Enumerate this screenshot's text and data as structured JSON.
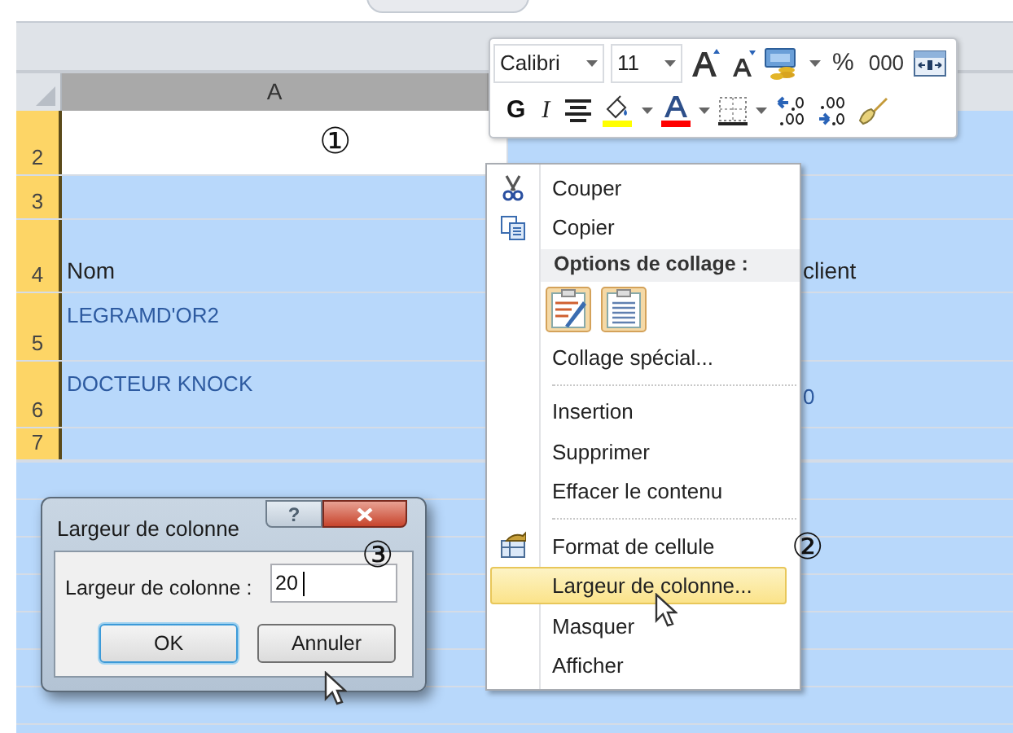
{
  "sheet": {
    "columns": [
      {
        "label": "A",
        "selected": true
      }
    ],
    "rows": [
      {
        "number": "2",
        "selected": true,
        "active": true
      },
      {
        "number": "3",
        "selected": true,
        "active": false
      },
      {
        "number": "4",
        "selected": true,
        "active": false,
        "kind": "heading",
        "a": "Nom",
        "b": "client"
      },
      {
        "number": "5",
        "selected": true,
        "active": false,
        "kind": "data",
        "a": "LEGRAMD'OR2"
      },
      {
        "number": "6",
        "selected": true,
        "active": false,
        "kind": "data",
        "a": "DOCTEUR KNOCK",
        "b": "0"
      },
      {
        "number": "7",
        "selected": true,
        "active": false
      }
    ]
  },
  "mini_toolbar": {
    "font": "Calibri",
    "size": "11",
    "percent": "%",
    "thousands": "000",
    "bold": "G",
    "italic": "I"
  },
  "context_menu": {
    "items": [
      {
        "kind": "item",
        "label": "Couper",
        "selected": false
      },
      {
        "kind": "item",
        "label": "Copier",
        "selected": false
      },
      {
        "kind": "header",
        "label": "Options de collage :"
      },
      {
        "kind": "paste_options"
      },
      {
        "kind": "item",
        "label": "Collage spécial...",
        "selected": false
      },
      {
        "kind": "separator"
      },
      {
        "kind": "item",
        "label": "Insertion",
        "selected": false
      },
      {
        "kind": "item",
        "label": "Supprimer",
        "selected": false
      },
      {
        "kind": "item",
        "label": "Effacer le contenu",
        "selected": false
      },
      {
        "kind": "separator"
      },
      {
        "kind": "item",
        "label": "Format de cellule",
        "selected": false
      },
      {
        "kind": "item",
        "label": "Largeur de colonne...",
        "selected": true
      },
      {
        "kind": "item",
        "label": "Masquer",
        "selected": false
      },
      {
        "kind": "item",
        "label": "Afficher",
        "selected": false
      }
    ]
  },
  "dialog": {
    "title": "Largeur de colonne",
    "help": "?",
    "field_label": "Largeur de colonne :",
    "value": "20",
    "buttons": [
      {
        "label": "OK",
        "default": true
      },
      {
        "label": "Annuler",
        "default": false
      }
    ]
  },
  "callouts": [
    {
      "label": "①"
    },
    {
      "label": "②"
    },
    {
      "label": "③"
    }
  ]
}
